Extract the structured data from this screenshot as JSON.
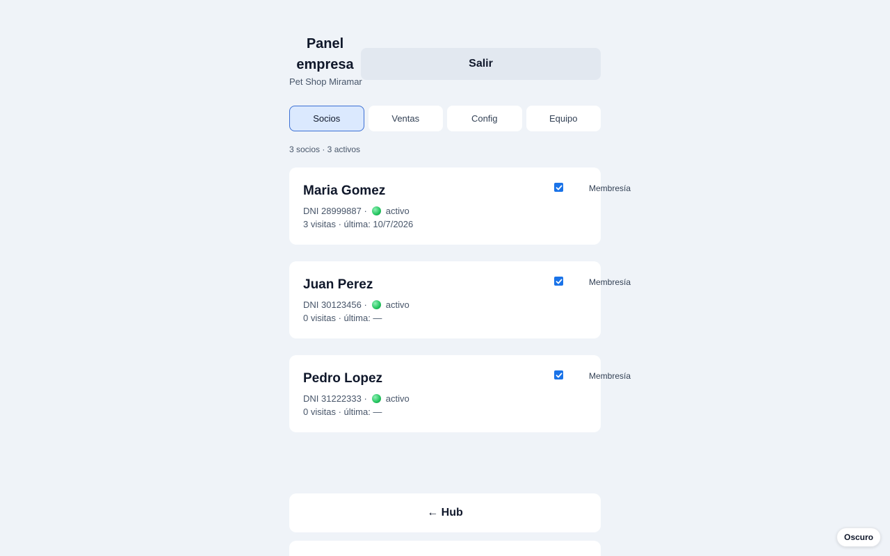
{
  "header": {
    "title": "Panel empresa",
    "subtitle": "Pet Shop Miramar",
    "logout_label": "Salir"
  },
  "tabs": [
    {
      "label": "Socios",
      "active": true
    },
    {
      "label": "Ventas",
      "active": false
    },
    {
      "label": "Config",
      "active": false
    },
    {
      "label": "Equipo",
      "active": false
    }
  ],
  "summary": "3 socios · 3 activos",
  "members": [
    {
      "name": "Maria Gomez",
      "dni": "DNI 28999887 ·",
      "status": "activo",
      "visits": "3 visitas · última: 10/7/2026",
      "membership_label": "Membresía",
      "membership_checked": true
    },
    {
      "name": "Juan Perez",
      "dni": "DNI 30123456 ·",
      "status": "activo",
      "visits": "0 visitas · última: —",
      "membership_label": "Membresía",
      "membership_checked": true
    },
    {
      "name": "Pedro Lopez",
      "dni": "DNI 31222333 ·",
      "status": "activo",
      "visits": "0 visitas · última: —",
      "membership_label": "Membresía",
      "membership_checked": true
    }
  ],
  "footer": {
    "hub_label": "← Hub",
    "theme_label": "Oscuro"
  },
  "colors": {
    "background": "#eff3f8",
    "accent": "#1a73e8",
    "active_tab_bg": "#dbe9fe",
    "status_active": "#22c55e"
  }
}
